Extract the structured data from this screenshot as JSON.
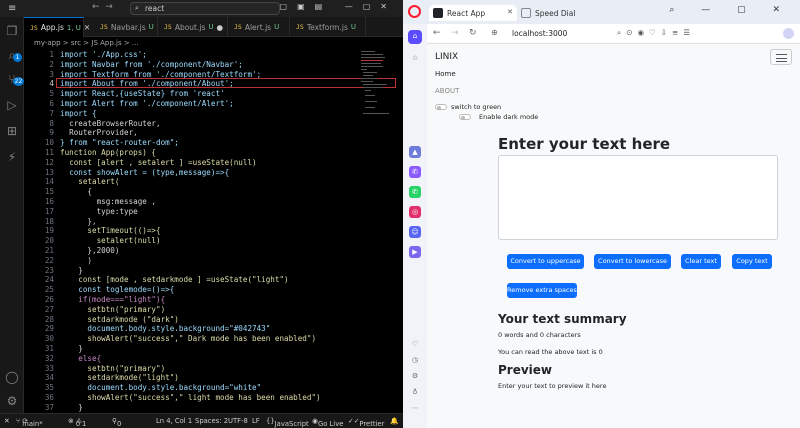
{
  "vscode": {
    "search_text": "react",
    "tabs": [
      {
        "label": "App.js",
        "status": "1, U",
        "active": true
      },
      {
        "label": "Navbar.js",
        "status": "U"
      },
      {
        "label": "About.js",
        "status": "U",
        "modified": true
      },
      {
        "label": "Alert.js",
        "status": "U"
      },
      {
        "label": "Textform.js",
        "status": "U"
      }
    ],
    "breadcrumb": "my-app  >  src  >  JS  App.js  >  ...",
    "activity_badges": {
      "search": "1",
      "scm": "22"
    },
    "code_lines": [
      {
        "n": "1",
        "t": "import './App.css';"
      },
      {
        "n": "2",
        "t": "import Navbar from './component/Navbar';"
      },
      {
        "n": "3",
        "t": "import Textform from './component/Textform';"
      },
      {
        "n": "4",
        "t": "import About from './component/About';"
      },
      {
        "n": "5",
        "t": "import React,{useState} from 'react'"
      },
      {
        "n": "6",
        "t": "import Alert from './component/Alert';"
      },
      {
        "n": "7",
        "t": "import {"
      },
      {
        "n": "8",
        "t": "  createBrowserRouter,"
      },
      {
        "n": "9",
        "t": "  RouterProvider,"
      },
      {
        "n": "10",
        "t": "} from \"react-router-dom\";"
      },
      {
        "n": "11",
        "t": "function App(props) {"
      },
      {
        "n": "12",
        "t": "  const [alert , setalert ] =useState(null)"
      },
      {
        "n": "13",
        "t": "  const showAlert = (type,message)=>{"
      },
      {
        "n": "14",
        "t": "    setalert("
      },
      {
        "n": "15",
        "t": "      {"
      },
      {
        "n": "16",
        "t": "        msg:message ,"
      },
      {
        "n": "17",
        "t": "        type:type"
      },
      {
        "n": "18",
        "t": "      },"
      },
      {
        "n": "19",
        "t": "      setTimeout(()=>{"
      },
      {
        "n": "20",
        "t": "        setalert(null)"
      },
      {
        "n": "21",
        "t": "      },2000)"
      },
      {
        "n": "22",
        "t": "      )"
      },
      {
        "n": "23",
        "t": "    }"
      },
      {
        "n": "24",
        "t": "    const [mode , setdarkmode ] =useState(\"light\")"
      },
      {
        "n": "25",
        "t": "    const toglemode=()=>{"
      },
      {
        "n": "26",
        "t": "    if(mode===\"light\"){"
      },
      {
        "n": "27",
        "t": "      setbtn(\"primary\")"
      },
      {
        "n": "28",
        "t": "      setdarkmode (\"dark\")"
      },
      {
        "n": "29",
        "t": "      document.body.style.background=\"#042743\""
      },
      {
        "n": "30",
        "t": "      showAlert(\"success\",\" Dark mode has been enabled\")"
      },
      {
        "n": "31",
        "t": "    }"
      },
      {
        "n": "32",
        "t": "    else{"
      },
      {
        "n": "33",
        "t": "      setbtn(\"primary\")"
      },
      {
        "n": "34",
        "t": "      setdarkmode(\"light\")"
      },
      {
        "n": "35",
        "t": "      document.body.style.background=\"white\""
      },
      {
        "n": "36",
        "t": "      showAlert(\"success\",\" light mode has been enabled\")"
      },
      {
        "n": "37",
        "t": "    }"
      }
    ],
    "status": {
      "branch": "main*",
      "problems": "0",
      "warnings": "1",
      "ports": "0",
      "position": "Ln 4, Col 1",
      "spaces": "Spaces: 2",
      "encoding": "UTF-8",
      "eol": "LF",
      "language": "JavaScript",
      "golive": "Go Live",
      "prettier": "Prettier"
    }
  },
  "browser": {
    "tabs": [
      {
        "label": "React App",
        "active": true
      },
      {
        "label": "Speed Dial"
      }
    ],
    "url": "localhost:3000",
    "colors": {
      "primary": "#0d6efd",
      "opera_red": "#ff1b2d"
    },
    "page": {
      "brand": "LINIX",
      "nav_home": "Home",
      "nav_about": "ABOUT",
      "switch_green": "switch to green",
      "switch_dark": "Enable dark mode",
      "heading": "Enter your text here",
      "buttons": [
        "Convert to uppercase",
        "Convert to lowercase",
        "Clear text",
        "Copy text",
        "Remove extra spaces"
      ],
      "summary_heading": "Your text summary",
      "summary_counts": "0 words and 0 characters",
      "read_time": "You can read the above text is 0",
      "preview_heading": "Preview",
      "preview_text": "Enter your text to preview it here"
    }
  }
}
